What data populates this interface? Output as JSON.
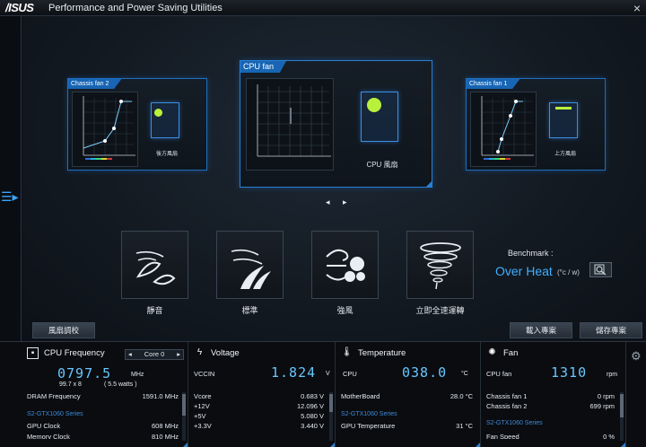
{
  "titlebar": {
    "logo": "/ISUS",
    "title": "Performance and Power Saving Utilities",
    "close": "×"
  },
  "fan_panels": {
    "left": {
      "tab": "Chassis fan 2",
      "case_label": "後方風扇"
    },
    "center": {
      "tab": "CPU fan",
      "case_label": "CPU 風扇"
    },
    "right": {
      "tab": "Chassis fan 1",
      "case_label": "上方風扇"
    }
  },
  "nav": {
    "arrows": "◂ ▸"
  },
  "modes": [
    {
      "label": "靜音"
    },
    {
      "label": "標準"
    },
    {
      "label": "強風"
    },
    {
      "label": "立即全速運轉"
    }
  ],
  "benchmark": {
    "label": "Benchmark :",
    "value": "Over Heat",
    "unit": "(°c / w)"
  },
  "buttons": {
    "tuning": "風扇調校",
    "load": "載入專案",
    "save": "儲存專案"
  },
  "cpu_freq": {
    "title": "CPU Frequency",
    "core_select": "Core 0",
    "value": "0797.5",
    "unit": "MHz",
    "sub1": "99.7  x  8",
    "sub2": "( 5.5  watts )",
    "dram_label": "DRAM Frequency",
    "dram_value": "1591.0  MHz",
    "gpu_name": "S2-GTX1060 Series",
    "gpu_clock_label": "GPU Clock",
    "gpu_clock_value": "608 MHz",
    "mem_label": "Memory Clock",
    "mem_value": "810 MHz"
  },
  "voltage": {
    "title": "Voltage",
    "main_label": "VCCIN",
    "main_value": "1.824",
    "main_unit": "V",
    "rows": [
      {
        "label": "Vcore",
        "value": "0.683  V"
      },
      {
        "label": "+12V",
        "value": "12.096  V"
      },
      {
        "label": "+5V",
        "value": "5.080  V"
      },
      {
        "label": "+3.3V",
        "value": "3.440  V"
      }
    ]
  },
  "temperature": {
    "title": "Temperature",
    "main_label": "CPU",
    "main_value": "038.0",
    "main_unit": "°C",
    "mb_label": "MotherBoard",
    "mb_value": "28.0 °C",
    "gpu_name": "S2-GTX1060 Series",
    "gpu_label": "GPU Temperature",
    "gpu_value": "31 °C"
  },
  "fan": {
    "title": "Fan",
    "main_label": "CPU fan",
    "main_value": "1310",
    "main_unit": "rpm",
    "rows": [
      {
        "label": "Chassis fan 1",
        "value": "0  rpm"
      },
      {
        "label": "Chassis fan 2",
        "value": "699  rpm"
      }
    ],
    "gpu_name": "S2-GTX1060 Series",
    "gpu_row_label": "Fan Speed",
    "gpu_row_value": "0 %"
  },
  "colors": {
    "accent": "#1f6fbf",
    "digits": "#67c6ff"
  }
}
